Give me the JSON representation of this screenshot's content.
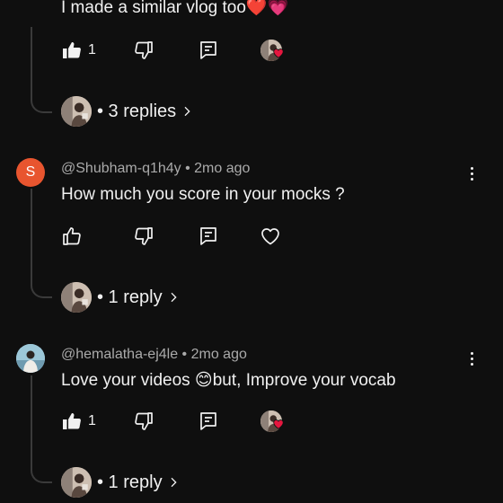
{
  "comments": [
    {
      "text": "I made a similar vlog too",
      "emoji": "❤️💗",
      "likes": "1",
      "replies_label": "• 3 replies"
    },
    {
      "avatar_letter": "S",
      "handle": "@Shubham-q1h4y",
      "time": "• 2mo ago",
      "text": "How much you score in your mocks ?",
      "replies_label": "• 1 reply"
    },
    {
      "handle": "@hemalatha-ej4le",
      "time": "• 2mo ago",
      "text": "Love your videos 😊but, Improve your vocab",
      "likes": "1",
      "replies_label": "• 1 reply"
    }
  ],
  "colors": {
    "background": "#0f0f0f",
    "avatar_s": "#e8552f",
    "heart": "#e5173f",
    "meta": "#aaaaaa"
  },
  "icons": [
    "thumbs-up-icon",
    "thumbs-down-icon",
    "reply-comment-icon",
    "creator-heart-icon",
    "chevron-right-icon",
    "more-vert-icon"
  ]
}
